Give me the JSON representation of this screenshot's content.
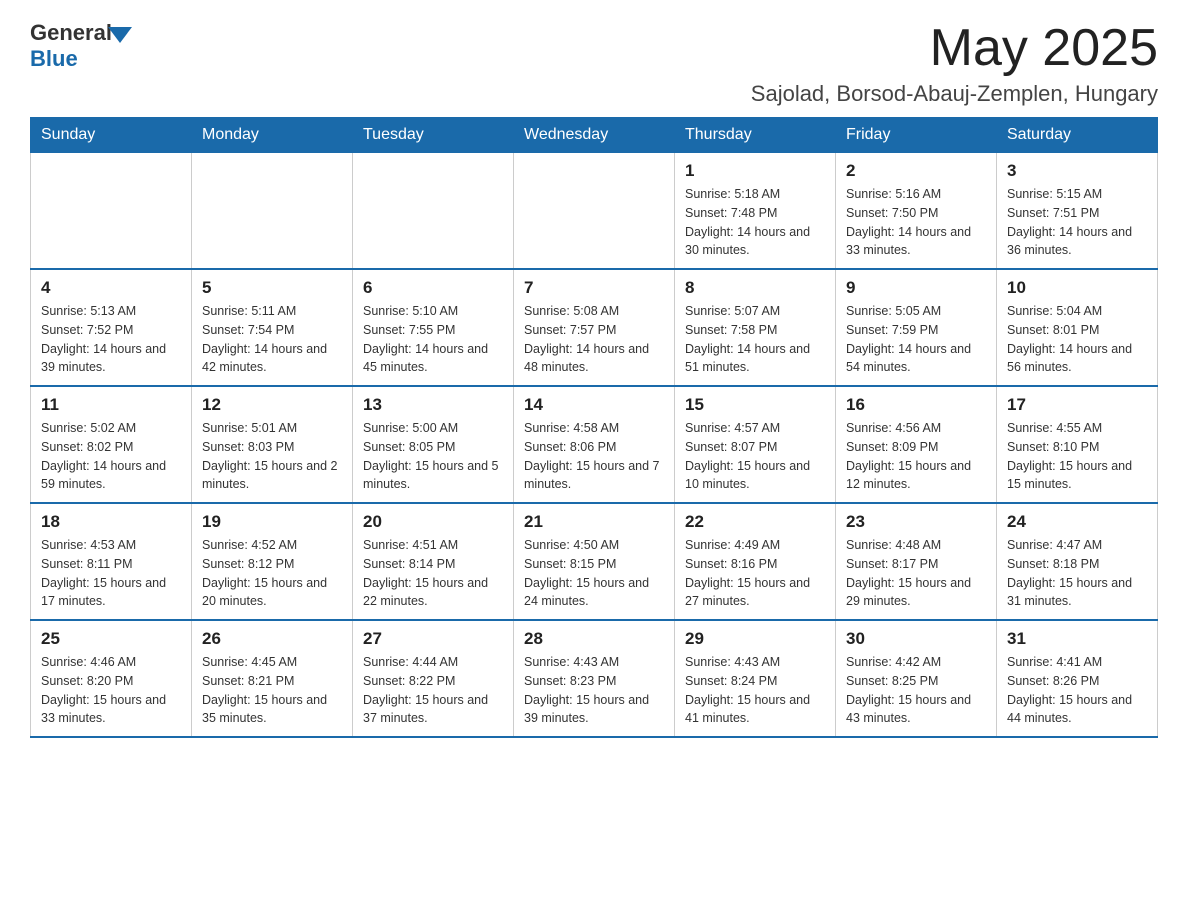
{
  "logo": {
    "text_general": "General",
    "text_blue": "Blue"
  },
  "header": {
    "month": "May 2025",
    "location": "Sajolad, Borsod-Abauj-Zemplen, Hungary"
  },
  "days_of_week": [
    "Sunday",
    "Monday",
    "Tuesday",
    "Wednesday",
    "Thursday",
    "Friday",
    "Saturday"
  ],
  "weeks": [
    [
      {
        "day": "",
        "info": ""
      },
      {
        "day": "",
        "info": ""
      },
      {
        "day": "",
        "info": ""
      },
      {
        "day": "",
        "info": ""
      },
      {
        "day": "1",
        "info": "Sunrise: 5:18 AM\nSunset: 7:48 PM\nDaylight: 14 hours and 30 minutes."
      },
      {
        "day": "2",
        "info": "Sunrise: 5:16 AM\nSunset: 7:50 PM\nDaylight: 14 hours and 33 minutes."
      },
      {
        "day": "3",
        "info": "Sunrise: 5:15 AM\nSunset: 7:51 PM\nDaylight: 14 hours and 36 minutes."
      }
    ],
    [
      {
        "day": "4",
        "info": "Sunrise: 5:13 AM\nSunset: 7:52 PM\nDaylight: 14 hours and 39 minutes."
      },
      {
        "day": "5",
        "info": "Sunrise: 5:11 AM\nSunset: 7:54 PM\nDaylight: 14 hours and 42 minutes."
      },
      {
        "day": "6",
        "info": "Sunrise: 5:10 AM\nSunset: 7:55 PM\nDaylight: 14 hours and 45 minutes."
      },
      {
        "day": "7",
        "info": "Sunrise: 5:08 AM\nSunset: 7:57 PM\nDaylight: 14 hours and 48 minutes."
      },
      {
        "day": "8",
        "info": "Sunrise: 5:07 AM\nSunset: 7:58 PM\nDaylight: 14 hours and 51 minutes."
      },
      {
        "day": "9",
        "info": "Sunrise: 5:05 AM\nSunset: 7:59 PM\nDaylight: 14 hours and 54 minutes."
      },
      {
        "day": "10",
        "info": "Sunrise: 5:04 AM\nSunset: 8:01 PM\nDaylight: 14 hours and 56 minutes."
      }
    ],
    [
      {
        "day": "11",
        "info": "Sunrise: 5:02 AM\nSunset: 8:02 PM\nDaylight: 14 hours and 59 minutes."
      },
      {
        "day": "12",
        "info": "Sunrise: 5:01 AM\nSunset: 8:03 PM\nDaylight: 15 hours and 2 minutes."
      },
      {
        "day": "13",
        "info": "Sunrise: 5:00 AM\nSunset: 8:05 PM\nDaylight: 15 hours and 5 minutes."
      },
      {
        "day": "14",
        "info": "Sunrise: 4:58 AM\nSunset: 8:06 PM\nDaylight: 15 hours and 7 minutes."
      },
      {
        "day": "15",
        "info": "Sunrise: 4:57 AM\nSunset: 8:07 PM\nDaylight: 15 hours and 10 minutes."
      },
      {
        "day": "16",
        "info": "Sunrise: 4:56 AM\nSunset: 8:09 PM\nDaylight: 15 hours and 12 minutes."
      },
      {
        "day": "17",
        "info": "Sunrise: 4:55 AM\nSunset: 8:10 PM\nDaylight: 15 hours and 15 minutes."
      }
    ],
    [
      {
        "day": "18",
        "info": "Sunrise: 4:53 AM\nSunset: 8:11 PM\nDaylight: 15 hours and 17 minutes."
      },
      {
        "day": "19",
        "info": "Sunrise: 4:52 AM\nSunset: 8:12 PM\nDaylight: 15 hours and 20 minutes."
      },
      {
        "day": "20",
        "info": "Sunrise: 4:51 AM\nSunset: 8:14 PM\nDaylight: 15 hours and 22 minutes."
      },
      {
        "day": "21",
        "info": "Sunrise: 4:50 AM\nSunset: 8:15 PM\nDaylight: 15 hours and 24 minutes."
      },
      {
        "day": "22",
        "info": "Sunrise: 4:49 AM\nSunset: 8:16 PM\nDaylight: 15 hours and 27 minutes."
      },
      {
        "day": "23",
        "info": "Sunrise: 4:48 AM\nSunset: 8:17 PM\nDaylight: 15 hours and 29 minutes."
      },
      {
        "day": "24",
        "info": "Sunrise: 4:47 AM\nSunset: 8:18 PM\nDaylight: 15 hours and 31 minutes."
      }
    ],
    [
      {
        "day": "25",
        "info": "Sunrise: 4:46 AM\nSunset: 8:20 PM\nDaylight: 15 hours and 33 minutes."
      },
      {
        "day": "26",
        "info": "Sunrise: 4:45 AM\nSunset: 8:21 PM\nDaylight: 15 hours and 35 minutes."
      },
      {
        "day": "27",
        "info": "Sunrise: 4:44 AM\nSunset: 8:22 PM\nDaylight: 15 hours and 37 minutes."
      },
      {
        "day": "28",
        "info": "Sunrise: 4:43 AM\nSunset: 8:23 PM\nDaylight: 15 hours and 39 minutes."
      },
      {
        "day": "29",
        "info": "Sunrise: 4:43 AM\nSunset: 8:24 PM\nDaylight: 15 hours and 41 minutes."
      },
      {
        "day": "30",
        "info": "Sunrise: 4:42 AM\nSunset: 8:25 PM\nDaylight: 15 hours and 43 minutes."
      },
      {
        "day": "31",
        "info": "Sunrise: 4:41 AM\nSunset: 8:26 PM\nDaylight: 15 hours and 44 minutes."
      }
    ]
  ]
}
